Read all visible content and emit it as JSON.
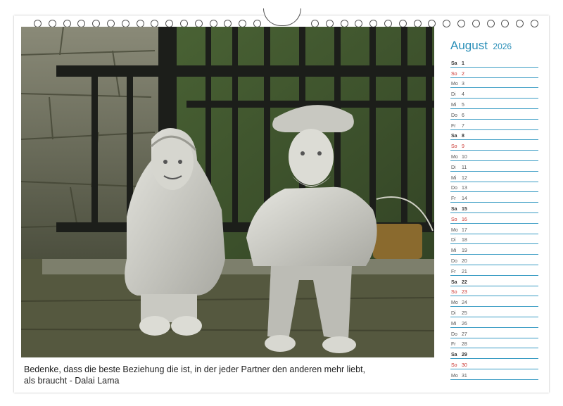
{
  "month": {
    "name": "August",
    "year": "2026"
  },
  "days": [
    {
      "dn": "Sa",
      "d": "1",
      "type": "sat"
    },
    {
      "dn": "So",
      "d": "2",
      "type": "sun"
    },
    {
      "dn": "Mo",
      "d": "3",
      "type": "wd"
    },
    {
      "dn": "Di",
      "d": "4",
      "type": "wd"
    },
    {
      "dn": "Mi",
      "d": "5",
      "type": "wd"
    },
    {
      "dn": "Do",
      "d": "6",
      "type": "wd"
    },
    {
      "dn": "Fr",
      "d": "7",
      "type": "wd"
    },
    {
      "dn": "Sa",
      "d": "8",
      "type": "sat"
    },
    {
      "dn": "So",
      "d": "9",
      "type": "sun"
    },
    {
      "dn": "Mo",
      "d": "10",
      "type": "wd"
    },
    {
      "dn": "Di",
      "d": "11",
      "type": "wd"
    },
    {
      "dn": "Mi",
      "d": "12",
      "type": "wd"
    },
    {
      "dn": "Do",
      "d": "13",
      "type": "wd"
    },
    {
      "dn": "Fr",
      "d": "14",
      "type": "wd"
    },
    {
      "dn": "Sa",
      "d": "15",
      "type": "sat"
    },
    {
      "dn": "So",
      "d": "16",
      "type": "sun"
    },
    {
      "dn": "Mo",
      "d": "17",
      "type": "wd"
    },
    {
      "dn": "Di",
      "d": "18",
      "type": "wd"
    },
    {
      "dn": "Mi",
      "d": "19",
      "type": "wd"
    },
    {
      "dn": "Do",
      "d": "20",
      "type": "wd"
    },
    {
      "dn": "Fr",
      "d": "21",
      "type": "wd"
    },
    {
      "dn": "Sa",
      "d": "22",
      "type": "sat"
    },
    {
      "dn": "So",
      "d": "23",
      "type": "sun"
    },
    {
      "dn": "Mo",
      "d": "24",
      "type": "wd"
    },
    {
      "dn": "Di",
      "d": "25",
      "type": "wd"
    },
    {
      "dn": "Mi",
      "d": "26",
      "type": "wd"
    },
    {
      "dn": "Do",
      "d": "27",
      "type": "wd"
    },
    {
      "dn": "Fr",
      "d": "28",
      "type": "wd"
    },
    {
      "dn": "Sa",
      "d": "29",
      "type": "sat"
    },
    {
      "dn": "So",
      "d": "30",
      "type": "sun"
    },
    {
      "dn": "Mo",
      "d": "31",
      "type": "wd"
    }
  ],
  "quote": {
    "line1": "Bedenke, dass die beste Beziehung die ist, in der jeder Partner den anderen mehr liebt,",
    "line2": "als braucht - Dalai Lama"
  },
  "colors": {
    "accent": "#2a8fb8",
    "sunday": "#c8322d",
    "line": "#3a9cc4"
  }
}
